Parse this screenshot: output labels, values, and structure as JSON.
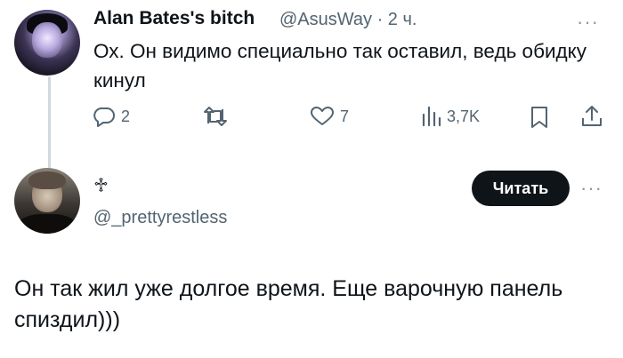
{
  "tweet1": {
    "display_name": "Alan Bates's bitch",
    "handle_time": "@AsusWay · 2 ч.",
    "text": "Ох. Он видимо специально так оставил, ведь обидку кинул",
    "more_glyph": "···",
    "actions": {
      "reply_icon": "reply-icon",
      "reply_count": "2",
      "retweet_icon": "retweet-icon",
      "like_icon": "heart-icon",
      "like_count": "7",
      "views_icon": "views-icon",
      "views_count": "3,7K",
      "bookmark_icon": "bookmark-icon",
      "share_icon": "share-icon"
    }
  },
  "tweet2": {
    "display_name_glyph": "♱",
    "handle": "@_prettyrestless",
    "follow_button": "Читать",
    "more_glyph": "···",
    "text": "Он так жил уже долгое время. Еще варочную панель спиздил)))"
  },
  "colors": {
    "text_primary": "#0f1419",
    "text_secondary": "#536471",
    "thread_line": "#cfd9de",
    "button_bg": "#0f1419",
    "button_text": "#ffffff"
  }
}
